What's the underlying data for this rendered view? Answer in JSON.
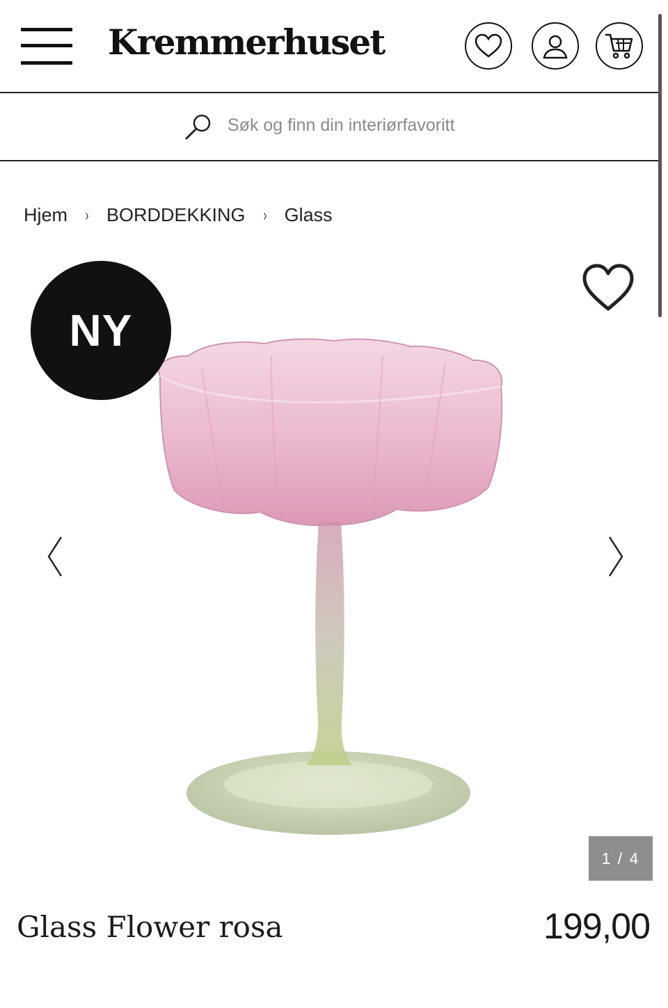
{
  "header": {
    "logo": "Kremmerhuset",
    "menu_icon": "hamburger-menu-icon",
    "wishlist_icon": "heart-icon",
    "account_icon": "user-icon",
    "cart_icon": "cart-icon"
  },
  "search": {
    "placeholder": "Søk og finn din interiørfavoritt",
    "icon": "search-icon"
  },
  "breadcrumb": {
    "items": [
      "Hjem",
      "BORDDEKKING",
      "Glass"
    ],
    "separator": "›"
  },
  "gallery": {
    "badge": "NY",
    "counter": "1 / 4",
    "prev_icon": "chevron-left-icon",
    "next_icon": "chevron-right-icon",
    "favorite_icon": "heart-icon"
  },
  "product": {
    "title": "Glass Flower rosa",
    "price": "199,00"
  },
  "colors": {
    "text": "#1a1a1a",
    "badge_bg": "#111111",
    "counter_bg": "#8e8e8e",
    "glass_pink": "#e8a9c4",
    "glass_green": "#b9c99a"
  }
}
